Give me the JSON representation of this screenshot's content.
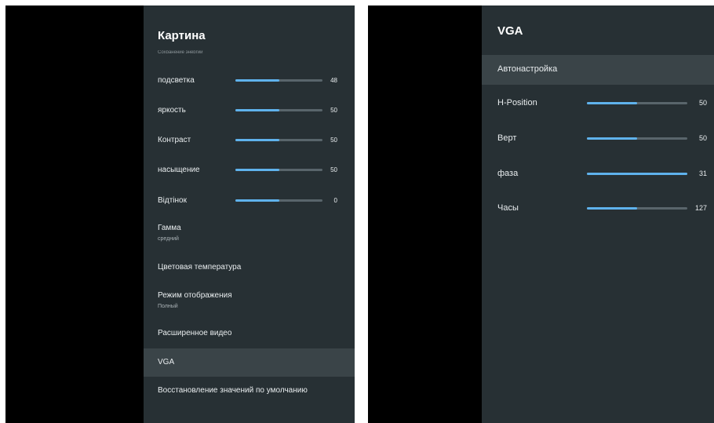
{
  "picture_menu": {
    "title": "Картина",
    "partial_item": "Сохранение энергии",
    "sliders": [
      {
        "label": "подсветка",
        "value": "48",
        "level": 0.5
      },
      {
        "label": "яркость",
        "value": "50",
        "level": 0.5
      },
      {
        "label": "Контраст",
        "value": "50",
        "level": 0.5
      },
      {
        "label": "насыщение",
        "value": "50",
        "level": 0.5
      },
      {
        "label": "Відтінок",
        "value": "0",
        "level": 0.5
      }
    ],
    "gamma": {
      "label": "Гамма",
      "value": "средний"
    },
    "color_temperature": "Цветовая температура",
    "display_mode": {
      "label": "Режим отображения",
      "value": "Полный"
    },
    "advanced_video": "Расширенное видео",
    "vga": "VGA",
    "restore_defaults": "Восстановление значений по умолчанию"
  },
  "vga_menu": {
    "title": "VGA",
    "auto_adjust": "Автонастройка",
    "sliders": [
      {
        "label": "H-Position",
        "value": "50",
        "level": 0.5
      },
      {
        "label": "Верт",
        "value": "50",
        "level": 0.5
      },
      {
        "label": "фаза",
        "value": "31",
        "level": 1.0
      },
      {
        "label": "Часы",
        "value": "127",
        "level": 0.5
      }
    ]
  },
  "colors": {
    "panel_background": "#273034",
    "selected_row": "#3a4448",
    "slider_fill": "#5fb2ec",
    "slider_track": "#59656b",
    "screen_background": "#000000"
  }
}
